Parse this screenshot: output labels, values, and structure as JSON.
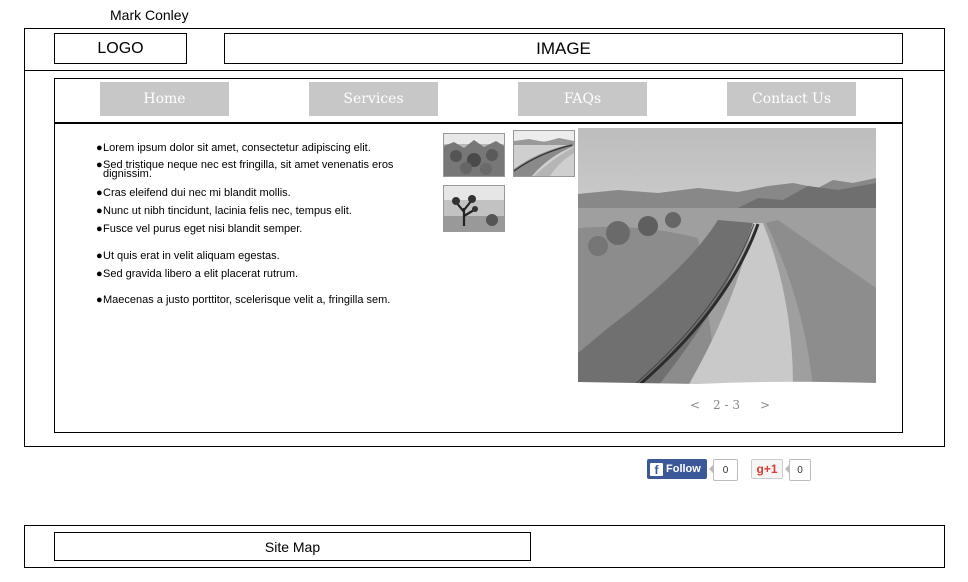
{
  "site_title": "Mark Conley",
  "header": {
    "logo_label": "LOGO",
    "image_label": "IMAGE"
  },
  "nav": {
    "items": [
      "Home",
      "Services",
      "FAQs",
      "Contact Us"
    ]
  },
  "content": {
    "bullets": [
      "Lorem ipsum dolor sit amet, consectetur adipiscing elit.",
      "Sed tristique neque nec est fringilla, sit amet venenatis eros dignissim.",
      "Cras eleifend dui nec mi blandit mollis.",
      "Nunc ut nibh tincidunt, lacinia felis nec, tempus elit.",
      "Fusce vel purus eget nisi blandit semper.",
      "Ut quis erat in velit aliquam egestas.",
      "Sed gravida libero a elit placerat rutrum.",
      "Maecenas a justo porttitor, scelerisque velit a, fringilla sem."
    ],
    "bullet_dot": "●"
  },
  "gallery": {
    "pager": {
      "prev": "<",
      "text": "2 - 3",
      "next": ">"
    }
  },
  "social": {
    "facebook_label": "Follow",
    "facebook_icon": "f",
    "facebook_count": "0",
    "gplus_label": "g+1",
    "gplus_count": "0",
    "colors": {
      "facebook": "#3b5998",
      "gplus": "#d73d32"
    }
  },
  "footer": {
    "sitemap_label": "Site Map"
  }
}
